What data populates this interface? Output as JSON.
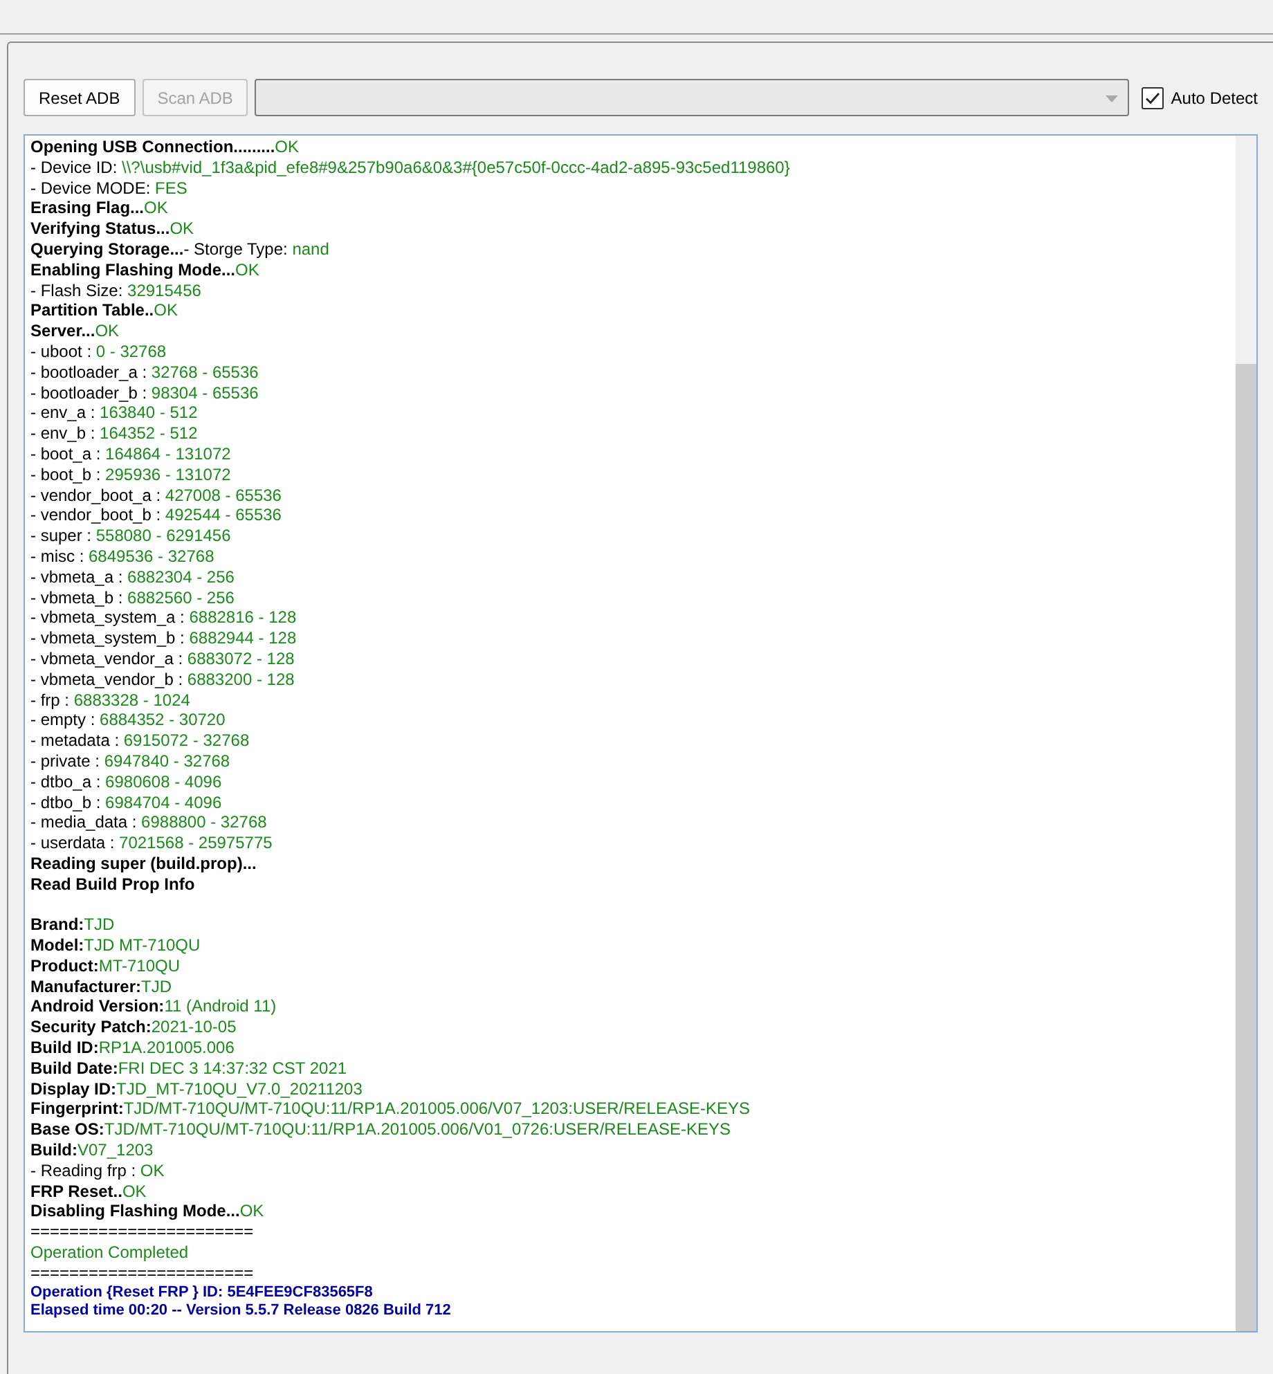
{
  "toolbar": {
    "buttons": [
      {
        "label": "Reset ADB",
        "disabled": false
      },
      {
        "label": "Scan ADB",
        "disabled": true
      }
    ],
    "auto_detect": {
      "label": "Auto Detect",
      "checked": true
    }
  },
  "log": {
    "lines": [
      {
        "kind": "entry",
        "parts": [
          {
            "kind": "label",
            "text": "Opening USB Connection........."
          },
          {
            "kind": "value",
            "text": "OK"
          }
        ]
      },
      {
        "kind": "entry",
        "parts": [
          {
            "kind": "text",
            "text": "- Device ID: "
          },
          {
            "kind": "value",
            "text": "\\\\?\\usb#vid_1f3a&pid_efe8#9&257b90a6&0&3#{0e57c50f-0ccc-4ad2-a895-93c5ed119860}"
          }
        ]
      },
      {
        "kind": "entry",
        "parts": [
          {
            "kind": "text",
            "text": "- Device MODE: "
          },
          {
            "kind": "value",
            "text": "FES"
          }
        ]
      },
      {
        "kind": "entry",
        "parts": [
          {
            "kind": "label",
            "text": "Erasing Flag..."
          },
          {
            "kind": "value",
            "text": "OK"
          }
        ]
      },
      {
        "kind": "entry",
        "parts": [
          {
            "kind": "label",
            "text": "Verifying Status..."
          },
          {
            "kind": "value",
            "text": "OK"
          }
        ]
      },
      {
        "kind": "entry",
        "parts": [
          {
            "kind": "label",
            "text": "Querying Storage..."
          },
          {
            "kind": "text",
            "text": "- Storge Type: "
          },
          {
            "kind": "value",
            "text": "nand"
          }
        ]
      },
      {
        "kind": "entry",
        "parts": [
          {
            "kind": "label",
            "text": "Enabling Flashing Mode..."
          },
          {
            "kind": "value",
            "text": "OK"
          }
        ]
      },
      {
        "kind": "entry",
        "parts": [
          {
            "kind": "text",
            "text": "- Flash Size: "
          },
          {
            "kind": "value",
            "text": "32915456"
          }
        ]
      },
      {
        "kind": "entry",
        "parts": [
          {
            "kind": "label",
            "text": "Partition Table.."
          },
          {
            "kind": "value",
            "text": "OK"
          }
        ]
      },
      {
        "kind": "entry",
        "parts": [
          {
            "kind": "label",
            "text": "Server..."
          },
          {
            "kind": "value",
            "text": "OK"
          }
        ]
      },
      {
        "kind": "entry",
        "parts": [
          {
            "kind": "text",
            "text": "- uboot : "
          },
          {
            "kind": "value",
            "text": "0 - 32768"
          }
        ]
      },
      {
        "kind": "entry",
        "parts": [
          {
            "kind": "text",
            "text": "- bootloader_a : "
          },
          {
            "kind": "value",
            "text": "32768 - 65536"
          }
        ]
      },
      {
        "kind": "entry",
        "parts": [
          {
            "kind": "text",
            "text": "- bootloader_b : "
          },
          {
            "kind": "value",
            "text": "98304 - 65536"
          }
        ]
      },
      {
        "kind": "entry",
        "parts": [
          {
            "kind": "text",
            "text": "- env_a : "
          },
          {
            "kind": "value",
            "text": "163840 - 512"
          }
        ]
      },
      {
        "kind": "entry",
        "parts": [
          {
            "kind": "text",
            "text": "- env_b : "
          },
          {
            "kind": "value",
            "text": "164352 - 512"
          }
        ]
      },
      {
        "kind": "entry",
        "parts": [
          {
            "kind": "text",
            "text": "- boot_a : "
          },
          {
            "kind": "value",
            "text": "164864 - 131072"
          }
        ]
      },
      {
        "kind": "entry",
        "parts": [
          {
            "kind": "text",
            "text": "- boot_b : "
          },
          {
            "kind": "value",
            "text": "295936 - 131072"
          }
        ]
      },
      {
        "kind": "entry",
        "parts": [
          {
            "kind": "text",
            "text": "- vendor_boot_a : "
          },
          {
            "kind": "value",
            "text": "427008 - 65536"
          }
        ]
      },
      {
        "kind": "entry",
        "parts": [
          {
            "kind": "text",
            "text": "- vendor_boot_b : "
          },
          {
            "kind": "value",
            "text": "492544 - 65536"
          }
        ]
      },
      {
        "kind": "entry",
        "parts": [
          {
            "kind": "text",
            "text": "- super : "
          },
          {
            "kind": "value",
            "text": "558080 - 6291456"
          }
        ]
      },
      {
        "kind": "entry",
        "parts": [
          {
            "kind": "text",
            "text": "- misc : "
          },
          {
            "kind": "value",
            "text": "6849536 - 32768"
          }
        ]
      },
      {
        "kind": "entry",
        "parts": [
          {
            "kind": "text",
            "text": "- vbmeta_a : "
          },
          {
            "kind": "value",
            "text": "6882304 - 256"
          }
        ]
      },
      {
        "kind": "entry",
        "parts": [
          {
            "kind": "text",
            "text": "- vbmeta_b : "
          },
          {
            "kind": "value",
            "text": "6882560 - 256"
          }
        ]
      },
      {
        "kind": "entry",
        "parts": [
          {
            "kind": "text",
            "text": "- vbmeta_system_a : "
          },
          {
            "kind": "value",
            "text": "6882816 - 128"
          }
        ]
      },
      {
        "kind": "entry",
        "parts": [
          {
            "kind": "text",
            "text": "- vbmeta_system_b : "
          },
          {
            "kind": "value",
            "text": "6882944 - 128"
          }
        ]
      },
      {
        "kind": "entry",
        "parts": [
          {
            "kind": "text",
            "text": "- vbmeta_vendor_a : "
          },
          {
            "kind": "value",
            "text": "6883072 - 128"
          }
        ]
      },
      {
        "kind": "entry",
        "parts": [
          {
            "kind": "text",
            "text": "- vbmeta_vendor_b : "
          },
          {
            "kind": "value",
            "text": "6883200 - 128"
          }
        ]
      },
      {
        "kind": "entry",
        "parts": [
          {
            "kind": "text",
            "text": "- frp : "
          },
          {
            "kind": "value",
            "text": "6883328 - 1024"
          }
        ]
      },
      {
        "kind": "entry",
        "parts": [
          {
            "kind": "text",
            "text": "- empty : "
          },
          {
            "kind": "value",
            "text": "6884352 - 30720"
          }
        ]
      },
      {
        "kind": "entry",
        "parts": [
          {
            "kind": "text",
            "text": "- metadata : "
          },
          {
            "kind": "value",
            "text": "6915072 - 32768"
          }
        ]
      },
      {
        "kind": "entry",
        "parts": [
          {
            "kind": "text",
            "text": "- private : "
          },
          {
            "kind": "value",
            "text": "6947840 - 32768"
          }
        ]
      },
      {
        "kind": "entry",
        "parts": [
          {
            "kind": "text",
            "text": "- dtbo_a : "
          },
          {
            "kind": "value",
            "text": "6980608 - 4096"
          }
        ]
      },
      {
        "kind": "entry",
        "parts": [
          {
            "kind": "text",
            "text": "- dtbo_b : "
          },
          {
            "kind": "value",
            "text": "6984704 - 4096"
          }
        ]
      },
      {
        "kind": "entry",
        "parts": [
          {
            "kind": "text",
            "text": "- media_data : "
          },
          {
            "kind": "value",
            "text": "6988800 - 32768"
          }
        ]
      },
      {
        "kind": "entry",
        "parts": [
          {
            "kind": "text",
            "text": "- userdata : "
          },
          {
            "kind": "value",
            "text": "7021568 - 25975775"
          }
        ]
      },
      {
        "kind": "entry",
        "parts": [
          {
            "kind": "label",
            "text": "Reading super (build.prop)..."
          }
        ]
      },
      {
        "kind": "entry",
        "parts": [
          {
            "kind": "label",
            "text": "Read Build Prop Info"
          }
        ]
      },
      {
        "kind": "blank"
      },
      {
        "kind": "entry",
        "parts": [
          {
            "kind": "label",
            "text": "Brand:"
          },
          {
            "kind": "value",
            "text": "TJD"
          }
        ]
      },
      {
        "kind": "entry",
        "parts": [
          {
            "kind": "label",
            "text": "Model:"
          },
          {
            "kind": "value",
            "text": "TJD MT-710QU"
          }
        ]
      },
      {
        "kind": "entry",
        "parts": [
          {
            "kind": "label",
            "text": "Product:"
          },
          {
            "kind": "value",
            "text": "MT-710QU"
          }
        ]
      },
      {
        "kind": "entry",
        "parts": [
          {
            "kind": "label",
            "text": "Manufacturer:"
          },
          {
            "kind": "value",
            "text": "TJD"
          }
        ]
      },
      {
        "kind": "entry",
        "parts": [
          {
            "kind": "label",
            "text": "Android Version:"
          },
          {
            "kind": "value",
            "text": "11 (Android 11)"
          }
        ]
      },
      {
        "kind": "entry",
        "parts": [
          {
            "kind": "label",
            "text": "Security Patch:"
          },
          {
            "kind": "value",
            "text": "2021-10-05"
          }
        ]
      },
      {
        "kind": "entry",
        "parts": [
          {
            "kind": "label",
            "text": "Build ID:"
          },
          {
            "kind": "value",
            "text": "RP1A.201005.006"
          }
        ]
      },
      {
        "kind": "entry",
        "parts": [
          {
            "kind": "label",
            "text": "Build Date:"
          },
          {
            "kind": "value",
            "text": "FRI DEC 3 14:37:32 CST 2021"
          }
        ]
      },
      {
        "kind": "entry",
        "parts": [
          {
            "kind": "label",
            "text": "Display ID:"
          },
          {
            "kind": "value",
            "text": "TJD_MT-710QU_V7.0_20211203"
          }
        ]
      },
      {
        "kind": "entry",
        "parts": [
          {
            "kind": "label",
            "text": "Fingerprint:"
          },
          {
            "kind": "value",
            "text": "TJD/MT-710QU/MT-710QU:11/RP1A.201005.006/V07_1203:USER/RELEASE-KEYS"
          }
        ]
      },
      {
        "kind": "entry",
        "parts": [
          {
            "kind": "label",
            "text": "Base OS:"
          },
          {
            "kind": "value",
            "text": "TJD/MT-710QU/MT-710QU:11/RP1A.201005.006/V01_0726:USER/RELEASE-KEYS"
          }
        ]
      },
      {
        "kind": "entry",
        "parts": [
          {
            "kind": "label",
            "text": "Build:"
          },
          {
            "kind": "value",
            "text": "V07_1203"
          }
        ]
      },
      {
        "kind": "entry",
        "parts": [
          {
            "kind": "text",
            "text": "- Reading frp : "
          },
          {
            "kind": "value",
            "text": "OK"
          }
        ]
      },
      {
        "kind": "entry",
        "parts": [
          {
            "kind": "label",
            "text": "FRP Reset.."
          },
          {
            "kind": "value",
            "text": "OK"
          }
        ]
      },
      {
        "kind": "entry",
        "parts": [
          {
            "kind": "label",
            "text": "Disabling Flashing Mode..."
          },
          {
            "kind": "value",
            "text": "OK"
          }
        ]
      },
      {
        "kind": "entry",
        "parts": [
          {
            "kind": "text",
            "text": "======================="
          }
        ]
      },
      {
        "kind": "entry",
        "parts": [
          {
            "kind": "value",
            "text": "Operation Completed"
          }
        ]
      },
      {
        "kind": "entry",
        "parts": [
          {
            "kind": "text",
            "text": "======================="
          }
        ]
      },
      {
        "kind": "footer",
        "parts": [
          {
            "kind": "info",
            "text": "Operation {Reset FRP } ID: 5E4FEE9CF83565F8"
          }
        ]
      },
      {
        "kind": "footer",
        "parts": [
          {
            "kind": "info",
            "text": "Elapsed time 00:20 -- Version 5.5.7 Release 0826 Build 712"
          }
        ]
      }
    ]
  }
}
